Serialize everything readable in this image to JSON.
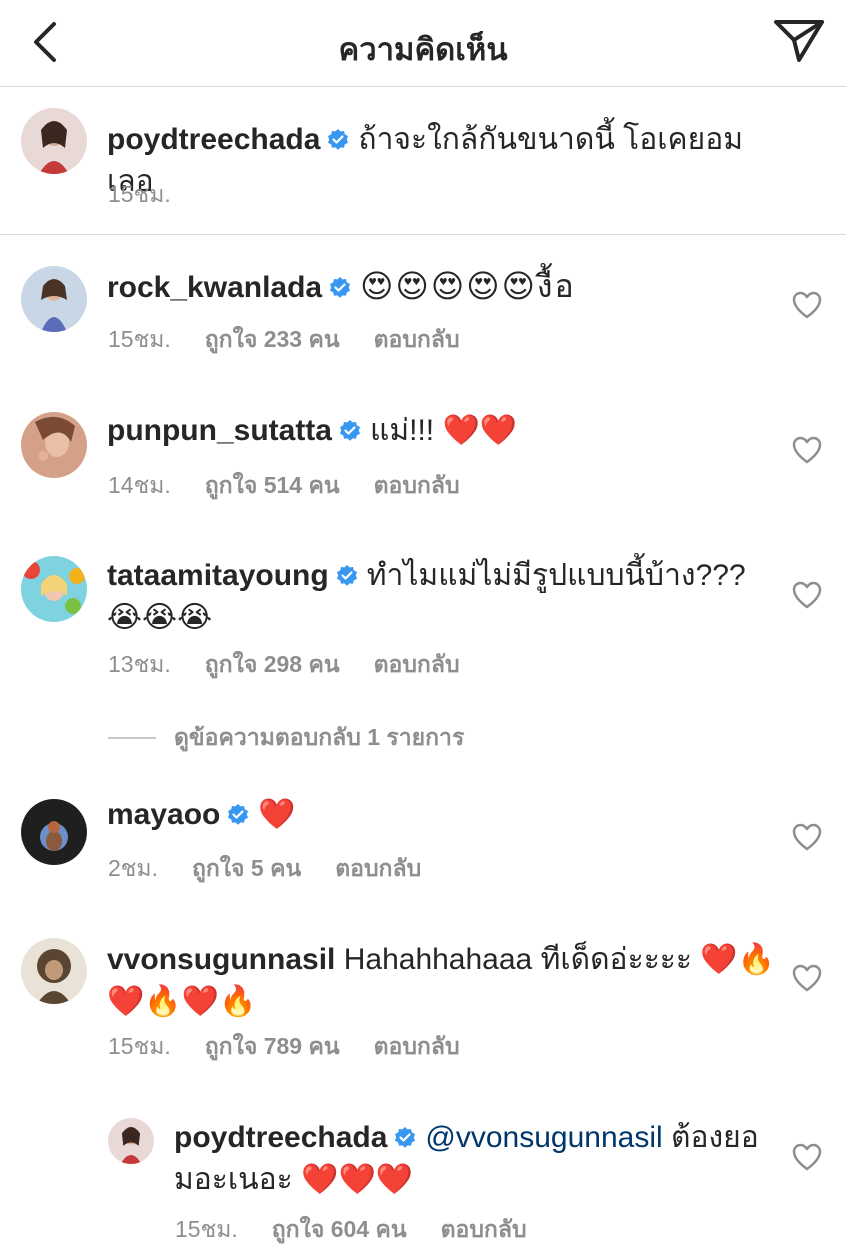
{
  "header": {
    "title": "ความคิดเห็น",
    "back_icon": "chevron-left-icon",
    "send_icon": "paper-plane-icon"
  },
  "caption": {
    "username": "poydtreechada",
    "text": "ถ้าจะใกล้กันขนาดนี้ โอเคยอมเลอ",
    "time": "15ชม."
  },
  "comments": [
    {
      "username": "rock_kwanlada",
      "text": "😍😍😍😍😍งื้อ",
      "time": "15ชม.",
      "likes": "ถูกใจ 233 คน",
      "reply": "ตอบกลับ"
    },
    {
      "username": "punpun_sutatta",
      "text": "แม่!!! ❤️❤️",
      "time": "14ชม.",
      "likes": "ถูกใจ 514 คน",
      "reply": "ตอบกลับ"
    },
    {
      "username": "tataamitayoung",
      "text": "ทำไมแม่ไม่มีรูปแบบนี้บ้าง??? 😭😭😭",
      "time": "13ชม.",
      "likes": "ถูกใจ 298 คน",
      "reply": "ตอบกลับ",
      "view_replies": "ดูข้อความตอบกลับ 1 รายการ"
    },
    {
      "username": "mayaoo",
      "text": "❤️",
      "time": "2ชม.",
      "likes": "ถูกใจ 5 คน",
      "reply": "ตอบกลับ"
    },
    {
      "username": "vvonsugunnasil",
      "text": "Hahahhahaaa ทีเด็ดอ่ะะะะ ❤️🔥❤️🔥❤️🔥",
      "time": "15ชม.",
      "likes": "ถูกใจ 789 คน",
      "reply": "ตอบกลับ"
    }
  ],
  "reply": {
    "username": "poydtreechada",
    "mention": "@vvonsugunnasil",
    "text": "ต้องยอมอะเนอะ ❤️❤️❤️",
    "time": "15ชม.",
    "likes": "ถูกใจ 604 คน",
    "reply": "ตอบกลับ"
  },
  "colors": {
    "verified": "#3897f0",
    "meta_text": "#8e8e8e",
    "mention": "#00376b",
    "divider": "#dbdbdb"
  }
}
